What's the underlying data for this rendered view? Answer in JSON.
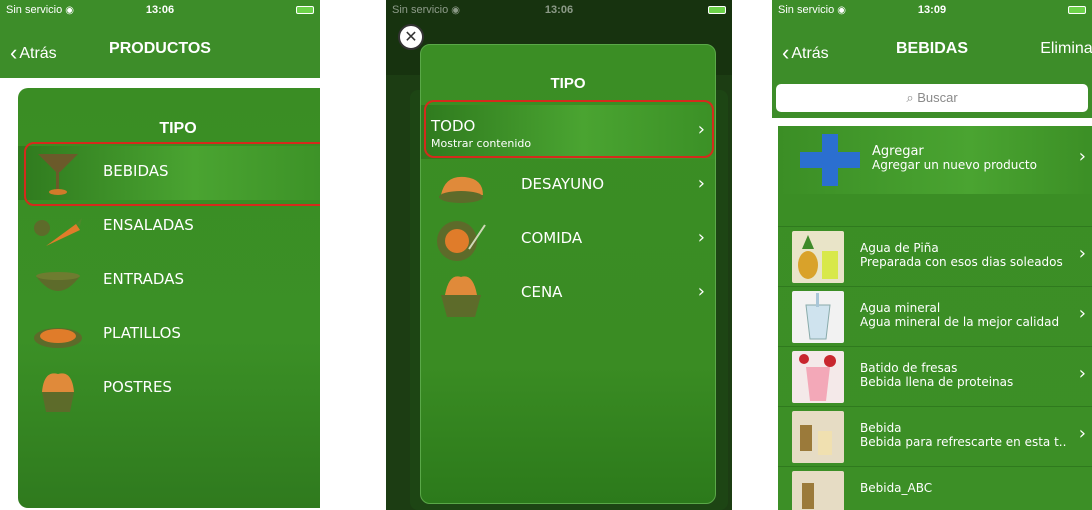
{
  "screen1": {
    "status": {
      "carrier": "Sin servicio",
      "time": "13:06"
    },
    "nav": {
      "back": "Atrás",
      "title": "PRODUCTOS"
    },
    "header": "TIPO",
    "items": [
      {
        "label": "BEBIDAS",
        "icon": "cocktail-glass-icon",
        "selected": true
      },
      {
        "label": "ENSALADAS",
        "icon": "salad-icon"
      },
      {
        "label": "ENTRADAS",
        "icon": "bowl-icon"
      },
      {
        "label": "PLATILLOS",
        "icon": "dish-icon"
      },
      {
        "label": "POSTRES",
        "icon": "cupcake-icon"
      }
    ]
  },
  "screen2": {
    "status": {
      "carrier": "Sin servicio",
      "time": "13:06"
    },
    "header": "TIPO",
    "todo": {
      "title": "TODO",
      "subtitle": "Mostrar contenido"
    },
    "items": [
      {
        "label": "DESAYUNO",
        "icon": "bread-icon"
      },
      {
        "label": "COMIDA",
        "icon": "plate-icon"
      },
      {
        "label": "CENA",
        "icon": "cup-icon"
      }
    ]
  },
  "screen3": {
    "status": {
      "carrier": "Sin servicio",
      "time": "13:09"
    },
    "nav": {
      "back": "Atrás",
      "title": "BEBIDAS",
      "right": "Eliminar"
    },
    "search_placeholder": "Buscar",
    "add": {
      "title": "Agregar",
      "subtitle": "Agregar un nuevo producto"
    },
    "products": [
      {
        "name": "Agua de Piña",
        "desc": "Preparada con esos dias soleados"
      },
      {
        "name": "Agua mineral",
        "desc": "Agua mineral de la mejor calidad"
      },
      {
        "name": "Batido de fresas",
        "desc": "Bebida llena de proteinas"
      },
      {
        "name": "Bebida",
        "desc": "Bebida para refrescarte en esta t.."
      },
      {
        "name": "Bebida_ABC",
        "desc": ""
      }
    ]
  },
  "colors": {
    "primary_green": "#3d8d29",
    "highlight_red": "#d42b1c"
  }
}
